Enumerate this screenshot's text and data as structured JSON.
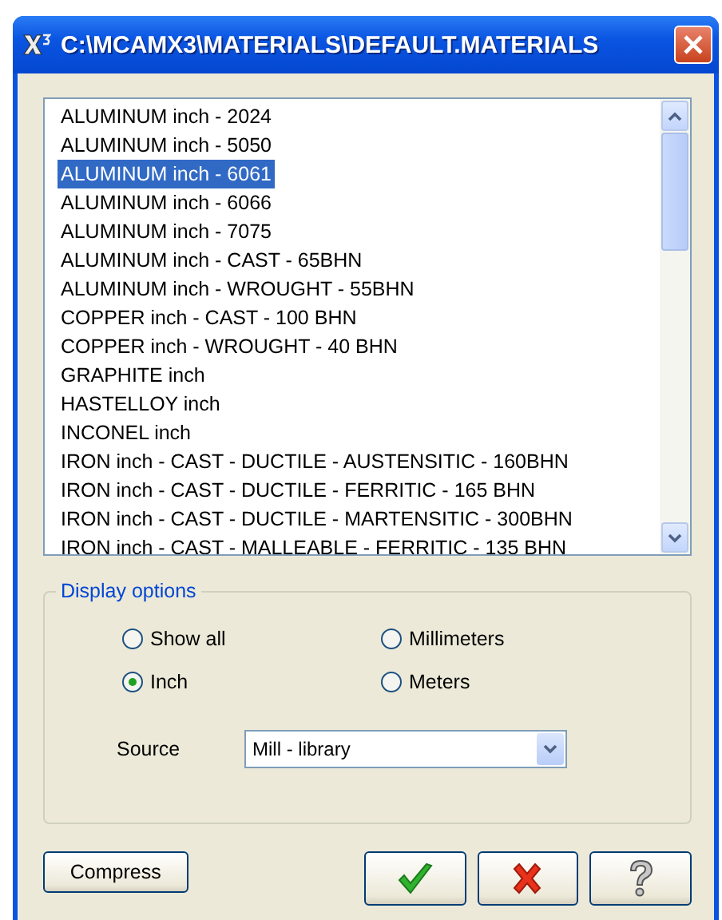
{
  "window": {
    "title": "C:\\MCAMX3\\MATERIALS\\DEFAULT.MATERIALS"
  },
  "materials": [
    {
      "label": "ALUMINUM inch - 2024",
      "selected": false
    },
    {
      "label": "ALUMINUM inch - 5050",
      "selected": false
    },
    {
      "label": "ALUMINUM inch - 6061",
      "selected": true
    },
    {
      "label": "ALUMINUM inch - 6066",
      "selected": false
    },
    {
      "label": "ALUMINUM inch - 7075",
      "selected": false
    },
    {
      "label": "ALUMINUM inch - CAST - 65BHN",
      "selected": false
    },
    {
      "label": "ALUMINUM inch - WROUGHT - 55BHN",
      "selected": false
    },
    {
      "label": "COPPER inch - CAST - 100 BHN",
      "selected": false
    },
    {
      "label": "COPPER inch - WROUGHT - 40 BHN",
      "selected": false
    },
    {
      "label": "GRAPHITE inch",
      "selected": false
    },
    {
      "label": "HASTELLOY inch",
      "selected": false
    },
    {
      "label": "INCONEL inch",
      "selected": false
    },
    {
      "label": "IRON inch - CAST - DUCTILE - AUSTENSITIC - 160BHN",
      "selected": false
    },
    {
      "label": "IRON inch - CAST - DUCTILE - FERRITIC - 165 BHN",
      "selected": false
    },
    {
      "label": "IRON inch - CAST - DUCTILE - MARTENSITIC - 300BHN",
      "selected": false
    },
    {
      "label": "IRON inch - CAST - MALLEABLE - FERRITIC - 135 BHN",
      "selected": false
    }
  ],
  "display_options": {
    "title": "Display options",
    "radios": [
      {
        "label": "Show all",
        "selected": false
      },
      {
        "label": "Millimeters",
        "selected": false
      },
      {
        "label": "Inch",
        "selected": true
      },
      {
        "label": "Meters",
        "selected": false
      }
    ],
    "source": {
      "label": "Source",
      "value": "Mill - library"
    }
  },
  "buttons": [
    {
      "kind": "text",
      "label": "Compress"
    },
    {
      "kind": "ok"
    },
    {
      "kind": "cancel"
    },
    {
      "kind": "help"
    }
  ]
}
